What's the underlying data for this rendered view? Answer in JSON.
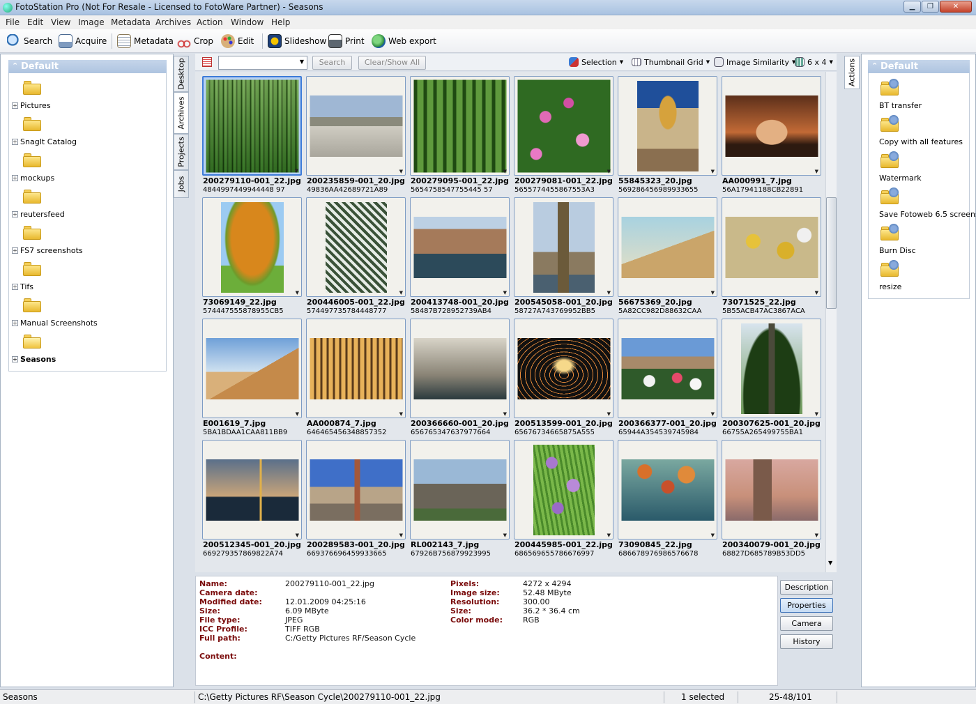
{
  "window": {
    "title": "FotoStation Pro (Not For Resale - Licensed to FotoWare Partner) - Seasons"
  },
  "menu": [
    "File",
    "Edit",
    "View",
    "Image",
    "Metadata",
    "Archives",
    "Action",
    "Window",
    "Help"
  ],
  "toolbar": {
    "search": "Search",
    "acquire": "Acquire",
    "metadata": "Metadata",
    "crop": "Crop",
    "edit": "Edit",
    "slideshow": "Slideshow",
    "print": "Print",
    "web_export": "Web export"
  },
  "left_panel": {
    "title": "Default",
    "folders": [
      "Pictures",
      "SnagIt Catalog",
      "mockups",
      "reutersfeed",
      "FS7 screenshots",
      "Tifs",
      "Manual Screenshots",
      "Seasons"
    ],
    "selected": "Seasons"
  },
  "left_tabs": [
    "Desktop",
    "Archives",
    "Projects",
    "Jobs"
  ],
  "grid_toolbar": {
    "search_value": "",
    "search_button": "Search",
    "clear_button": "Clear/Show All",
    "selection": "Selection",
    "view": "Thumbnail Grid",
    "similarity": "Image Similarity",
    "grid_size": "6 x 4"
  },
  "thumbnails": [
    {
      "name": "200279110-001_22.jpg",
      "code": "4844997449944448 97",
      "selected": true
    },
    {
      "name": "200235859-001_20.jpg",
      "code": "49836AA42689721A89"
    },
    {
      "name": "200279095-001_22.jpg",
      "code": "5654758547755445 57"
    },
    {
      "name": "200279081-001_22.jpg",
      "code": "5655774455867553A3"
    },
    {
      "name": "55845323_20.jpg",
      "code": "569286456989933655"
    },
    {
      "name": "AA000991_7.jpg",
      "code": "56A17941188CB22891"
    },
    {
      "name": "73069149_22.jpg",
      "code": "574447555878955CB5"
    },
    {
      "name": "200446005-001_22.jpg",
      "code": "574497735784448777"
    },
    {
      "name": "200413748-001_20.jpg",
      "code": "58487B728952739AB4"
    },
    {
      "name": "200545058-001_20.jpg",
      "code": "58727A743769952BB5"
    },
    {
      "name": "56675369_20.jpg",
      "code": "5A82CC982D88632CAA"
    },
    {
      "name": "73071525_22.jpg",
      "code": "5B55ACB47AC3867ACA"
    },
    {
      "name": "E001619_7.jpg",
      "code": "5BA1BDAA1CAA811BB9"
    },
    {
      "name": "AA000874_7.jpg",
      "code": "646465456348857352"
    },
    {
      "name": "200366660-001_20.jpg",
      "code": "656765347637977664"
    },
    {
      "name": "200513599-001_20.jpg",
      "code": "65676734665875A555"
    },
    {
      "name": "200366377-001_20.jpg",
      "code": "65944A354539745984"
    },
    {
      "name": "200307625-001_20.jpg",
      "code": "66755A265499755BA1"
    },
    {
      "name": "200512345-001_20.jpg",
      "code": "669279357869822A74"
    },
    {
      "name": "200289583-001_20.jpg",
      "code": "669376696459933665"
    },
    {
      "name": "RL002143_7.jpg",
      "code": "67926B756879923995"
    },
    {
      "name": "200445985-001_22.jpg",
      "code": "686569655786676997"
    },
    {
      "name": "73090845_22.jpg",
      "code": "686678976986576678"
    },
    {
      "name": "200340079-001_20.jpg",
      "code": "68827D685789B53DD5"
    }
  ],
  "info": {
    "name_label": "Name:",
    "name": "200279110-001_22.jpg",
    "camera_label": "Camera date:",
    "camera": "",
    "modified_label": "Modified date:",
    "modified": "12.01.2009 04:25:16",
    "size_label": "Size:",
    "size": "6.09 MByte",
    "filetype_label": "File type:",
    "filetype": "JPEG",
    "icc_label": "ICC Profile:",
    "icc": "TIFF RGB",
    "path_label": "Full path:",
    "path": "C:/Getty Pictures RF/Season Cycle",
    "content_label": "Content:",
    "pixels_label": "Pixels:",
    "pixels": "4272 x 4294",
    "imgsize_label": "Image size:",
    "imgsize": "52.48 MByte",
    "resolution_label": "Resolution:",
    "resolution": "300.00",
    "size2_label": "Size:",
    "size2": "36.2 * 36.4 cm",
    "color_label": "Color mode:",
    "color": "RGB"
  },
  "info_buttons": [
    "Description",
    "Properties",
    "Camera",
    "History"
  ],
  "actions_panel": {
    "tab": "Actions",
    "title": "Default",
    "items": [
      "BT transfer",
      "Copy with all features",
      "Watermark",
      "Save Fotoweb 6.5 screens",
      "Burn Disc",
      "resize"
    ]
  },
  "status": {
    "left": "Seasons",
    "path": "C:\\Getty Pictures RF\\Season Cycle\\200279110-001_22.jpg",
    "selected": "1 selected",
    "range": "25-48/101"
  },
  "colors": {
    "accent": "#3d7bd8",
    "label_red": "#7a0b0b",
    "panel_head": "#aec4e0"
  }
}
